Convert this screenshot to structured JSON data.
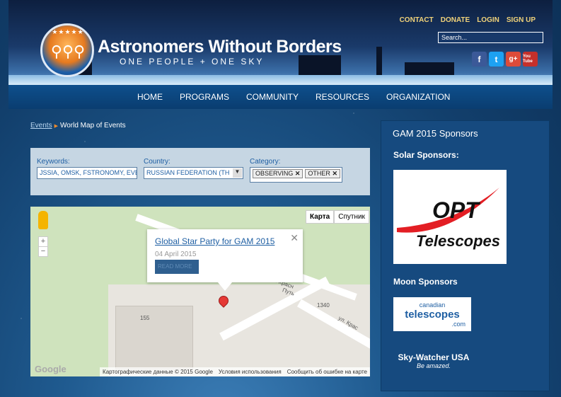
{
  "header": {
    "title": "Astronomers Without Borders",
    "tagline": "ONE PEOPLE + ONE SKY",
    "top_links": [
      "CONTACT",
      "DONATE",
      "LOGIN",
      "SIGN UP"
    ],
    "search_placeholder": "Search...",
    "social": [
      "f",
      "t",
      "g+",
      "You Tube"
    ]
  },
  "nav": [
    "HOME",
    "PROGRAMS",
    "COMMUNITY",
    "RESOURCES",
    "ORGANIZATION"
  ],
  "breadcrumb": {
    "link": "Events",
    "current": "World Map of Events"
  },
  "filters": {
    "keywords_label": "Keywords:",
    "keywords_value": "JSSIA, OMSK, FSTRONOMY, EVE",
    "country_label": "Country:",
    "country_value": "RUSSIAN FEDERATION (TH",
    "category_label": "Category:",
    "category_tags": [
      "OBSERVING",
      "OTHER"
    ]
  },
  "map": {
    "type_buttons": [
      "Карта",
      "Спутник"
    ],
    "zoom_in": "+",
    "zoom_out": "−",
    "event_title": "Global Star Party for GAM 2015",
    "event_date": "04 April 2015",
    "read_more": "READ MORE",
    "label_155": "155",
    "label_1340": "1340",
    "label_street1": "ул. Красн",
    "label_street2": "ул. Крас",
    "label_put": "Путь",
    "footer": [
      "Картографические данные © 2015 Google",
      "Условия использования",
      "Сообщить об ошибке на карте"
    ],
    "google": "Google"
  },
  "sidebar": {
    "title": "GAM 2015 Sponsors",
    "solar": "Solar Sponsors:",
    "moon": "Moon Sponsors",
    "opt1": "OPT",
    "opt2": "Telescopes",
    "canada1": "canadian",
    "canada2": "telescopes",
    "canada3": ".com",
    "sky": "Sky-Watcher USA",
    "sky_tag": "Be amazed."
  },
  "colors": {
    "accent": "#f0d27a",
    "link": "#1f5fa3",
    "panel": "#164a7f"
  }
}
